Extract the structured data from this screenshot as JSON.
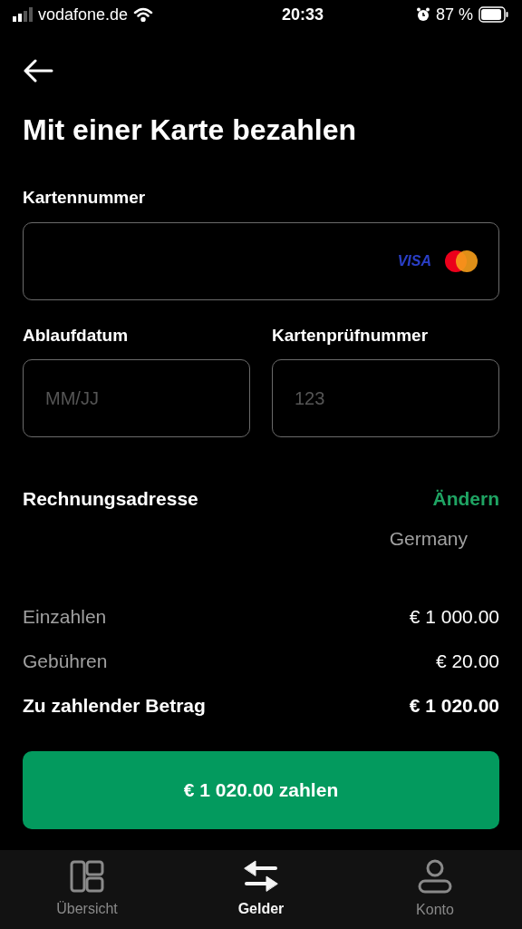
{
  "status_bar": {
    "carrier": "vodafone.de",
    "time": "20:33",
    "battery": "87 %"
  },
  "title": "Mit einer Karte bezahlen",
  "card_number": {
    "label": "Kartennummer",
    "brand": "VISA"
  },
  "expiry": {
    "label": "Ablaufdatum",
    "placeholder": "MM/JJ"
  },
  "cvc": {
    "label": "Kartenprüfnummer",
    "placeholder": "123"
  },
  "billing": {
    "label": "Rechnungsadresse",
    "action": "Ändern",
    "country": "Germany"
  },
  "summary": [
    {
      "label": "Einzahlen",
      "value": "€ 1 000.00",
      "total": false
    },
    {
      "label": "Gebühren",
      "value": "€ 20.00",
      "total": false
    },
    {
      "label": "Zu zahlender Betrag",
      "value": "€ 1 020.00",
      "total": true
    }
  ],
  "pay_button": "€ 1 020.00 zahlen",
  "nav": [
    {
      "kind": "overview",
      "label": "Übersicht",
      "selected": false
    },
    {
      "kind": "transfer",
      "label": "Gelder",
      "selected": true
    },
    {
      "kind": "account",
      "label": "Konto",
      "selected": false
    }
  ]
}
